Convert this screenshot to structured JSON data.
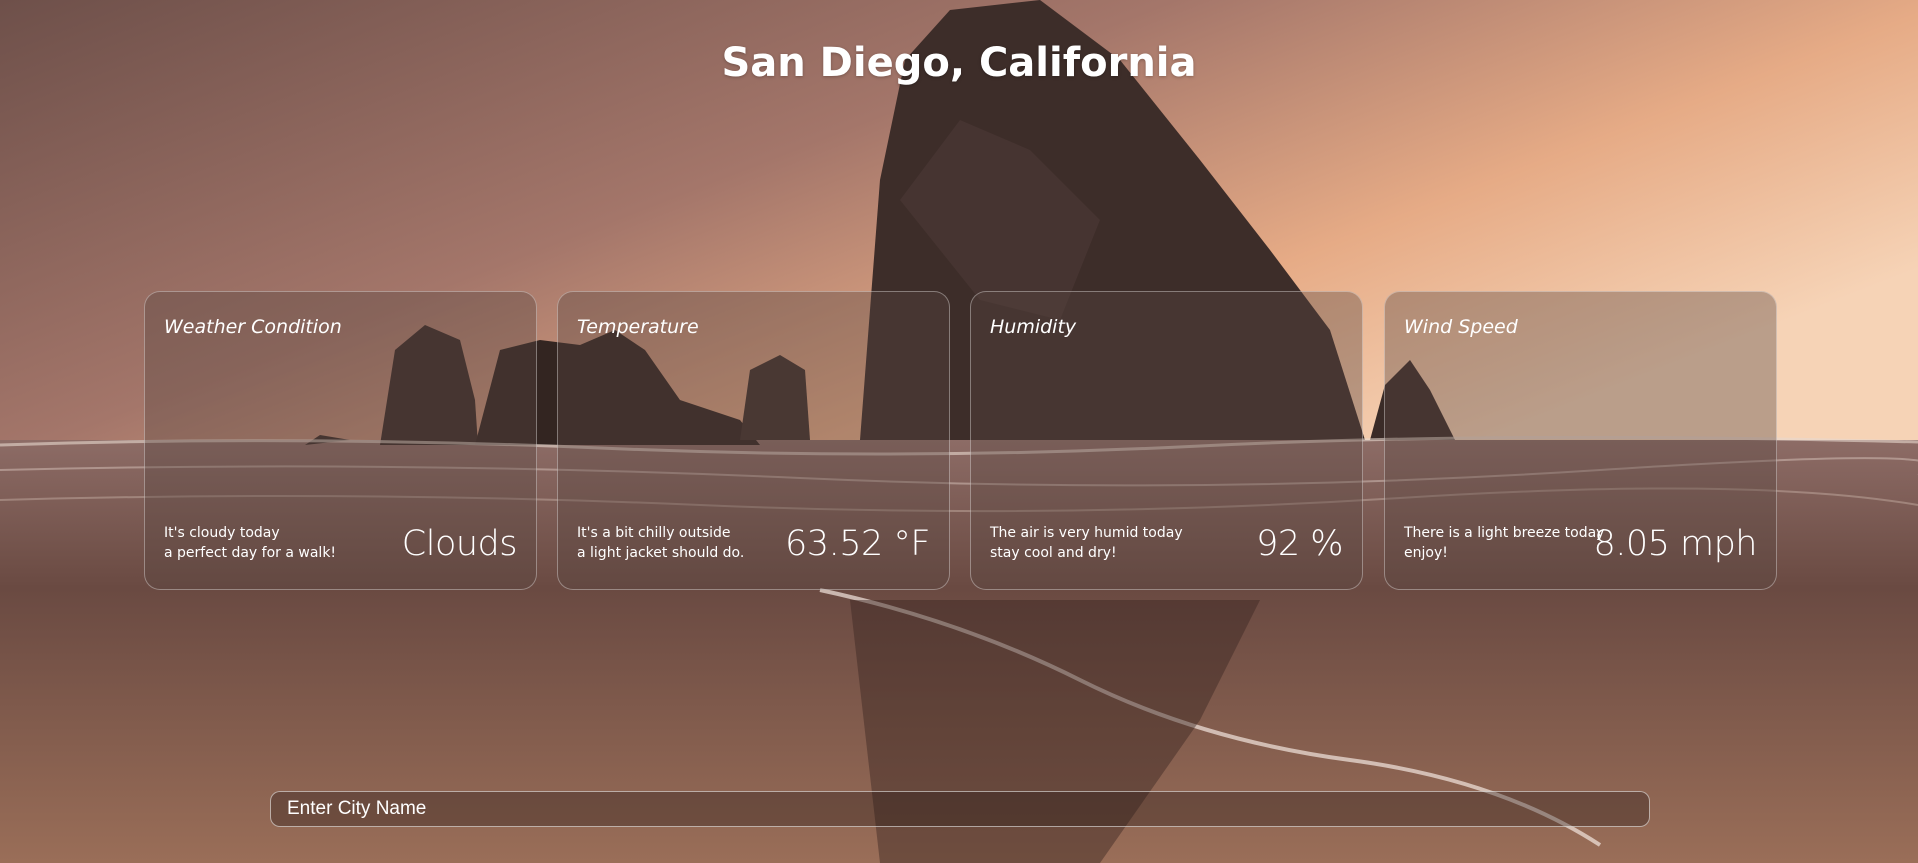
{
  "city_title": "San Diego, California",
  "cards": [
    {
      "title": "Weather Condition",
      "line1": "It's cloudy today",
      "line2": "a perfect day for a walk!",
      "value": "Clouds"
    },
    {
      "title": "Temperature",
      "line1": "It's a bit chilly outside",
      "line2": "a light jacket should do.",
      "value": "63.52 °F"
    },
    {
      "title": "Humidity",
      "line1": "The air is very humid today",
      "line2": "stay cool and dry!",
      "value": "92 %"
    },
    {
      "title": "Wind Speed",
      "line1": "There is a light breeze today",
      "line2": "enjoy!",
      "value": "8.05 mph"
    }
  ],
  "search": {
    "placeholder": "Enter City Name"
  },
  "colors": {
    "card_bg": "#5a4642",
    "sky": "#d49a7c",
    "sea": "#8f6a5e"
  }
}
